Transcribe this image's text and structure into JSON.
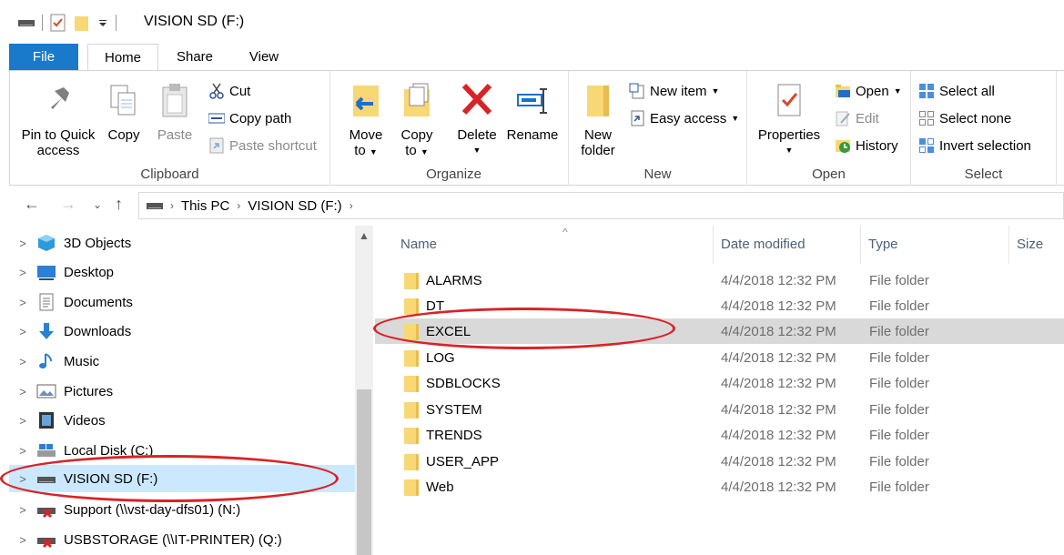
{
  "window": {
    "title": "VISION SD (F:)"
  },
  "ribbon_tabs": [
    "File",
    "Home",
    "Share",
    "View"
  ],
  "clipboard": {
    "pin_label_1": "Pin to Quick",
    "pin_label_2": "access",
    "copy": "Copy",
    "paste": "Paste",
    "cut": "Cut",
    "copy_path": "Copy path",
    "paste_shortcut": "Paste shortcut",
    "group": "Clipboard"
  },
  "organize": {
    "move_to_1": "Move",
    "move_to_2": "to",
    "copy_to_1": "Copy",
    "copy_to_2": "to",
    "delete": "Delete",
    "rename": "Rename",
    "group": "Organize"
  },
  "new": {
    "new_folder_1": "New",
    "new_folder_2": "folder",
    "new_item": "New item",
    "easy_access": "Easy access",
    "group": "New"
  },
  "open": {
    "properties": "Properties",
    "open": "Open",
    "edit": "Edit",
    "history": "History",
    "group": "Open"
  },
  "select": {
    "select_all": "Select all",
    "select_none": "Select none",
    "invert_selection": "Invert selection",
    "group": "Select"
  },
  "address": {
    "crumbs": [
      "This PC",
      "VISION SD (F:)"
    ]
  },
  "nav_items": [
    {
      "label": "3D Objects",
      "icon": "3d-objects-icon"
    },
    {
      "label": "Desktop",
      "icon": "desktop-icon"
    },
    {
      "label": "Documents",
      "icon": "documents-icon"
    },
    {
      "label": "Downloads",
      "icon": "downloads-icon"
    },
    {
      "label": "Music",
      "icon": "music-icon"
    },
    {
      "label": "Pictures",
      "icon": "pictures-icon"
    },
    {
      "label": "Videos",
      "icon": "videos-icon"
    },
    {
      "label": "Local Disk (C:)",
      "icon": "local-disk-icon"
    },
    {
      "label": "VISION SD (F:)",
      "icon": "drive-icon",
      "selected": true
    },
    {
      "label": "Support (\\\\vst-day-dfs01) (N:)",
      "icon": "network-drive-disconnected-icon"
    },
    {
      "label": "USBSTORAGE (\\\\IT-PRINTER) (Q:)",
      "icon": "network-drive-disconnected-icon"
    }
  ],
  "columns": {
    "name": "Name",
    "date": "Date modified",
    "type": "Type",
    "size": "Size"
  },
  "files": [
    {
      "name": "ALARMS",
      "date": "4/4/2018 12:32 PM",
      "type": "File folder"
    },
    {
      "name": "DT",
      "date": "4/4/2018 12:32 PM",
      "type": "File folder"
    },
    {
      "name": "EXCEL",
      "date": "4/4/2018 12:32 PM",
      "type": "File folder",
      "selected": true
    },
    {
      "name": "LOG",
      "date": "4/4/2018 12:32 PM",
      "type": "File folder"
    },
    {
      "name": "SDBLOCKS",
      "date": "4/4/2018 12:32 PM",
      "type": "File folder"
    },
    {
      "name": "SYSTEM",
      "date": "4/4/2018 12:32 PM",
      "type": "File folder"
    },
    {
      "name": "TRENDS",
      "date": "4/4/2018 12:32 PM",
      "type": "File folder"
    },
    {
      "name": "USER_APP",
      "date": "4/4/2018 12:32 PM",
      "type": "File folder"
    },
    {
      "name": "Web",
      "date": "4/4/2018 12:32 PM",
      "type": "File folder"
    }
  ],
  "colors": {
    "accent": "#1979ca",
    "selection": "#cce8ff",
    "row_highlight": "#d9d9d9",
    "annotation": "#d92327"
  }
}
